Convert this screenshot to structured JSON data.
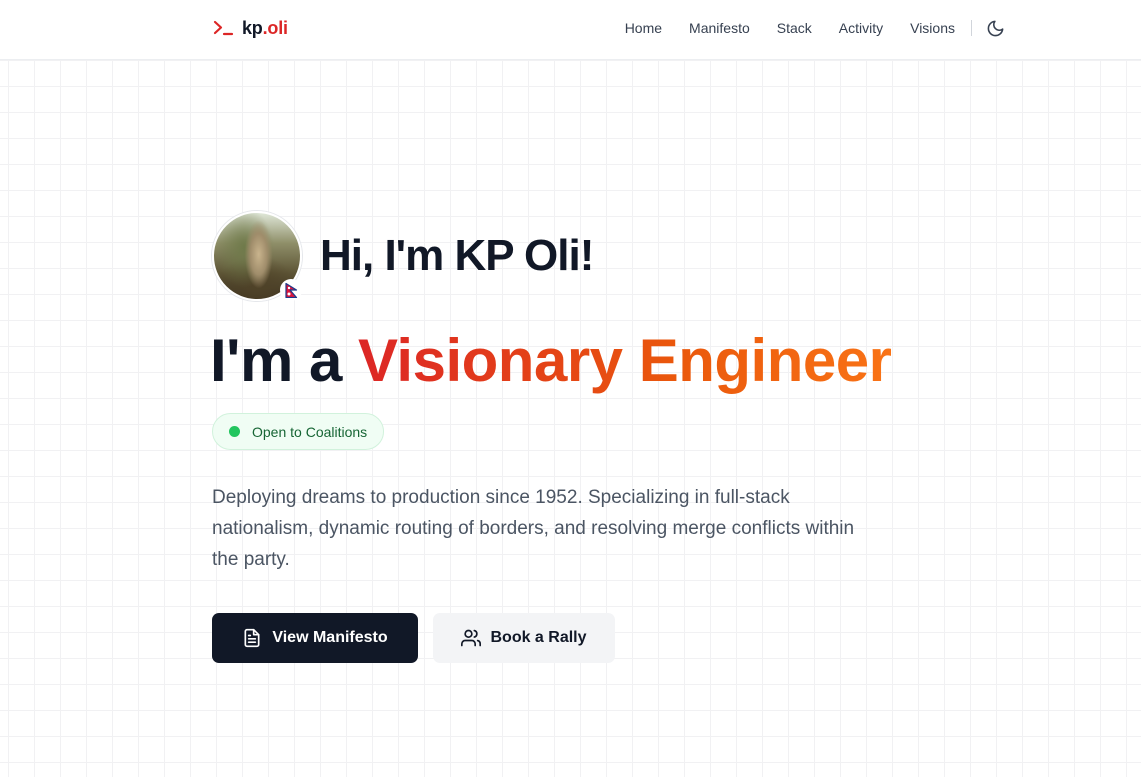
{
  "brand": {
    "prefix": "kp",
    "suffix": ".oli",
    "icon": "terminal-icon",
    "accent_color": "#dc2626"
  },
  "nav": {
    "items": [
      {
        "label": "Home"
      },
      {
        "label": "Manifesto"
      },
      {
        "label": "Stack"
      },
      {
        "label": "Activity"
      },
      {
        "label": "Visions"
      }
    ],
    "theme_toggle_icon": "moon-icon"
  },
  "hero": {
    "greeting": "Hi, I'm KP Oli!",
    "avatar_badge_icon": "nepal-flag-icon",
    "headline_prefix": "I'm a ",
    "headline_accent": "Visionary Engineer",
    "status": {
      "label": "Open to Coalitions",
      "color": "#22c55e"
    },
    "bio": "Deploying dreams to production since 1952. Specializing in full-stack nationalism, dynamic routing of borders, and resolving merge conflicts within the party.",
    "primary_cta": {
      "label": "View Manifesto",
      "icon": "document-icon"
    },
    "secondary_cta": {
      "label": "Book a Rally",
      "icon": "users-icon"
    }
  }
}
